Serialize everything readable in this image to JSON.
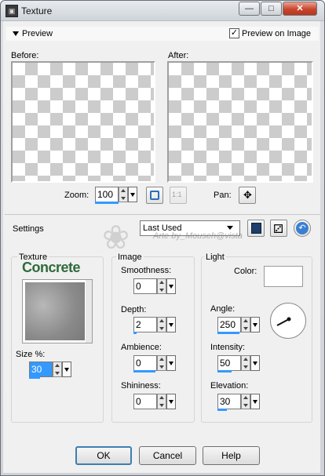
{
  "window": {
    "title": "Texture",
    "icon": "texture-app-icon"
  },
  "preview": {
    "header": "Preview",
    "preview_on_image_label": "Preview on Image",
    "preview_on_image_checked": true,
    "before_label": "Before:",
    "after_label": "After:",
    "zoom_label": "Zoom:",
    "zoom_value": "100",
    "pan_label": "Pan:"
  },
  "settings": {
    "label": "Settings",
    "preset_value": "Last Used"
  },
  "watermark": "Arte by_Mouseh@vista",
  "texture": {
    "group_label": "Texture",
    "name": "Concrete",
    "size_label": "Size %:",
    "size_value": "30"
  },
  "image": {
    "group_label": "Image",
    "smoothness_label": "Smoothness:",
    "smoothness_value": "0",
    "depth_label": "Depth:",
    "depth_value": "2",
    "ambience_label": "Ambience:",
    "ambience_value": "0",
    "shininess_label": "Shininess:",
    "shininess_value": "0"
  },
  "light": {
    "group_label": "Light",
    "color_label": "Color:",
    "color_value": "#ffffff",
    "angle_label": "Angle:",
    "angle_value": "250",
    "intensity_label": "Intensity:",
    "intensity_value": "50",
    "elevation_label": "Elevation:",
    "elevation_value": "30"
  },
  "buttons": {
    "ok": "OK",
    "cancel": "Cancel",
    "help": "Help"
  }
}
